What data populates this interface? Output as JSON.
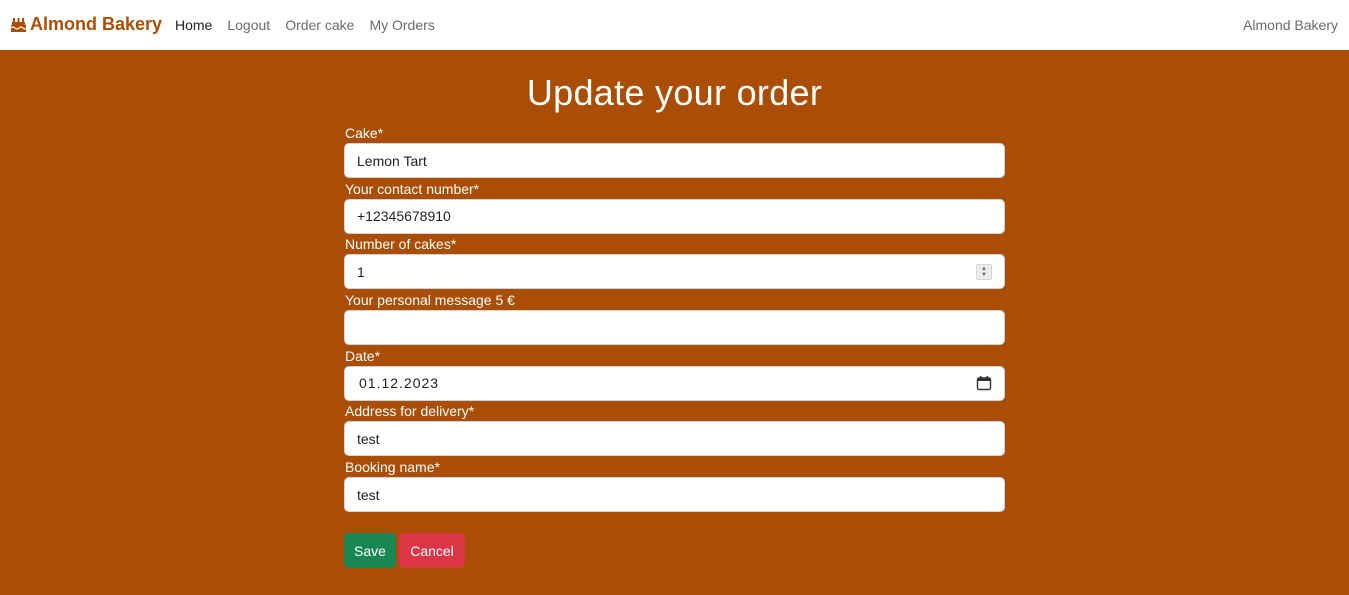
{
  "navbar": {
    "brand": "Almond Bakery",
    "brand_icon": "cake-icon",
    "links": [
      "Home",
      "Logout",
      "Order cake",
      "My Orders"
    ],
    "active": "Home",
    "right_text": "Almond Bakery"
  },
  "page": {
    "title": "Update your order"
  },
  "form": {
    "cake": {
      "label": "Cake*",
      "value": "Lemon Tart"
    },
    "contact": {
      "label": "Your contact number*",
      "value": "+12345678910"
    },
    "number": {
      "label": "Number of cakes*",
      "value": "1"
    },
    "message": {
      "label": "Your personal message 5 €",
      "value": ""
    },
    "date": {
      "label": "Date*",
      "value": "01.12.2023",
      "icon": "calendar-icon"
    },
    "address": {
      "label": "Address for delivery*",
      "value": "test"
    },
    "booking": {
      "label": "Booking name*",
      "value": "test"
    }
  },
  "buttons": {
    "save": "Save",
    "cancel": "Cancel"
  },
  "colors": {
    "background": "#a94e04",
    "brand": "#a94e04",
    "save": "#198754",
    "cancel": "#dc3545"
  }
}
